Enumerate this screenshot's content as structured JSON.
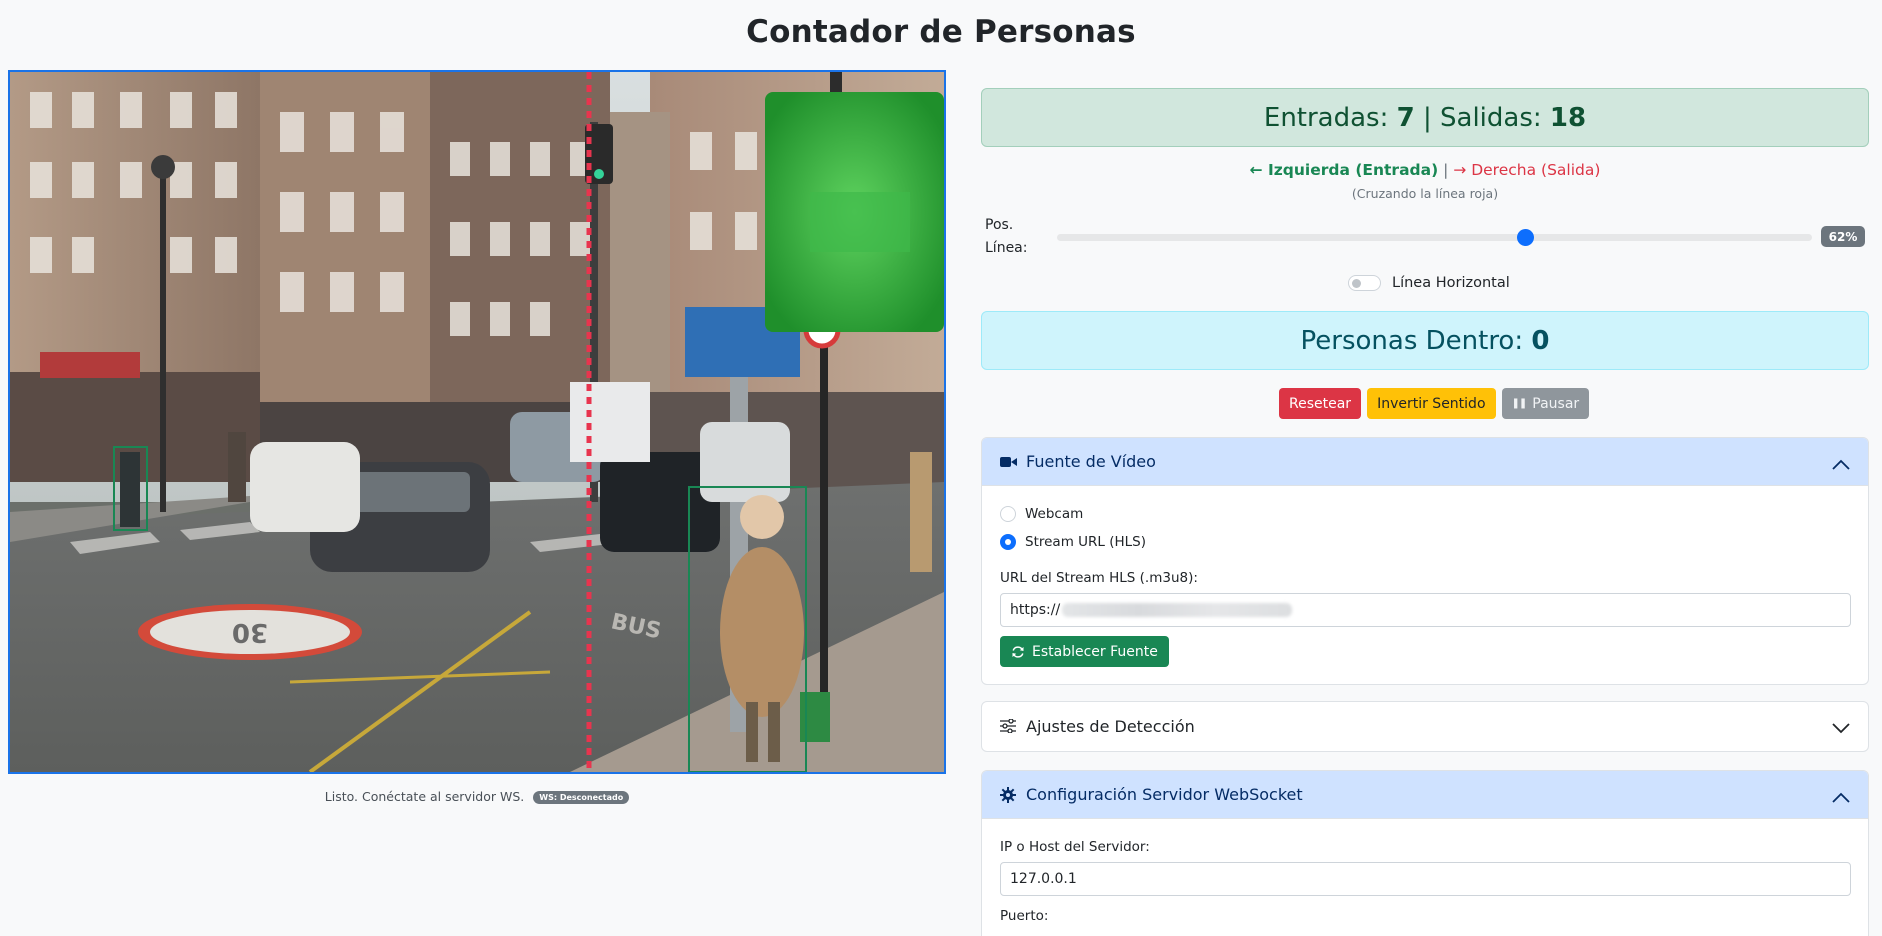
{
  "page": {
    "title": "Contador de Personas"
  },
  "video": {
    "status_text": "Listo. Conéctate al servidor WS.",
    "ws_badge": "WS: Desconectado",
    "speed_sign": "30",
    "road_text": "BUS",
    "line_color": "#e8344e",
    "box_color": "#198754"
  },
  "counts": {
    "entradas_label": "Entradas:",
    "entradas_value": "7",
    "separator": "|",
    "salidas_label": "Salidas:",
    "salidas_value": "18"
  },
  "direction": {
    "left": "← Izquierda (Entrada)",
    "separator": "|",
    "right": "→ Derecha (Salida)",
    "note": "(Cruzando la línea roja)"
  },
  "line_position": {
    "label_line1": "Pos.",
    "label_line2": "Línea:",
    "value": 0.62,
    "badge": "62%"
  },
  "horizontal_switch": {
    "label": "Línea Horizontal",
    "checked": false
  },
  "inside": {
    "label": "Personas Dentro:",
    "value": "0"
  },
  "buttons": {
    "reset": "Resetear",
    "invert": "Invertir Sentido",
    "pause_glyph": "❚❚",
    "pause": "Pausar"
  },
  "video_source": {
    "title": "Fuente de Vídeo",
    "icon": "video-camera-icon",
    "options": [
      "Webcam",
      "Stream URL (HLS)"
    ],
    "selected": "Stream URL (HLS)",
    "url_label": "URL del Stream HLS (.m3u8):",
    "url_value": "https://",
    "submit": "Establecer Fuente"
  },
  "detection": {
    "title": "Ajustes de Detección",
    "icon": "sliders-icon"
  },
  "websocket": {
    "title": "Configuración Servidor WebSocket",
    "icon": "gear-icon",
    "host_label": "IP o Host del Servidor:",
    "host_value": "127.0.0.1",
    "port_label": "Puerto:"
  },
  "colors": {
    "primary": "#0d6efd",
    "success_bg": "#d1e7dd",
    "info_bg": "#cff4fc",
    "danger": "#dc3545",
    "warning": "#ffc107",
    "accordion_open": "#cfe2ff"
  }
}
